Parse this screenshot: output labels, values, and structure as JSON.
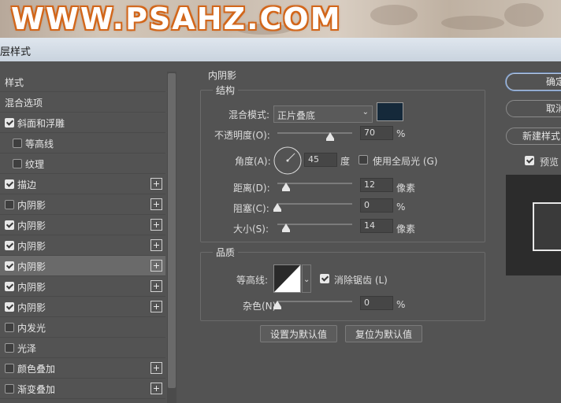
{
  "watermark": {
    "text": "WWW.PSAHZ.COM"
  },
  "dialog": {
    "title": "层样式"
  },
  "left_list": {
    "items": [
      {
        "label": "样式",
        "checkbox": false,
        "checked": false,
        "plus": false,
        "indent": false,
        "active": false
      },
      {
        "label": "混合选项",
        "checkbox": false,
        "checked": false,
        "plus": false,
        "indent": false,
        "active": false
      },
      {
        "label": "斜面和浮雕",
        "checkbox": true,
        "checked": true,
        "plus": false,
        "indent": false,
        "active": false
      },
      {
        "label": "等高线",
        "checkbox": true,
        "checked": false,
        "plus": false,
        "indent": true,
        "active": false
      },
      {
        "label": "纹理",
        "checkbox": true,
        "checked": false,
        "plus": false,
        "indent": true,
        "active": false
      },
      {
        "label": "描边",
        "checkbox": true,
        "checked": true,
        "plus": true,
        "indent": false,
        "active": false
      },
      {
        "label": "内阴影",
        "checkbox": true,
        "checked": false,
        "plus": true,
        "indent": false,
        "active": false
      },
      {
        "label": "内阴影",
        "checkbox": true,
        "checked": true,
        "plus": true,
        "indent": false,
        "active": false
      },
      {
        "label": "内阴影",
        "checkbox": true,
        "checked": true,
        "plus": true,
        "indent": false,
        "active": false
      },
      {
        "label": "内阴影",
        "checkbox": true,
        "checked": true,
        "plus": true,
        "indent": false,
        "active": true
      },
      {
        "label": "内阴影",
        "checkbox": true,
        "checked": true,
        "plus": true,
        "indent": false,
        "active": false
      },
      {
        "label": "内阴影",
        "checkbox": true,
        "checked": true,
        "plus": true,
        "indent": false,
        "active": false
      },
      {
        "label": "内发光",
        "checkbox": true,
        "checked": false,
        "plus": false,
        "indent": false,
        "active": false
      },
      {
        "label": "光泽",
        "checkbox": true,
        "checked": false,
        "plus": false,
        "indent": false,
        "active": false
      },
      {
        "label": "颜色叠加",
        "checkbox": true,
        "checked": false,
        "plus": true,
        "indent": false,
        "active": false
      },
      {
        "label": "渐变叠加",
        "checkbox": true,
        "checked": false,
        "plus": true,
        "indent": false,
        "active": false
      }
    ]
  },
  "inner_shadow": {
    "section_title": "内阴影",
    "structure_title": "结构",
    "blend_mode_label": "混合模式:",
    "blend_mode_value": "正片叠底",
    "shadow_color": "#15293a",
    "opacity_label": "不透明度(O):",
    "opacity_value": "70",
    "opacity_unit": "%",
    "opacity_level": 0.7,
    "angle_label": "角度(A):",
    "angle_value": "45",
    "angle_unit": "度",
    "angle_degrees": 45,
    "global_light_label": "使用全局光 (G)",
    "global_light_checked": false,
    "distance_label": "距离(D):",
    "distance_value": "12",
    "distance_unit": "像素",
    "distance_level": 0.12,
    "choke_label": "阻塞(C):",
    "choke_value": "0",
    "choke_unit": "%",
    "choke_level": 0.0,
    "size_label": "大小(S):",
    "size_value": "14",
    "size_unit": "像素",
    "size_level": 0.12,
    "quality_title": "品质",
    "contour_label": "等高线:",
    "anti_alias_label": "消除锯齿 (L)",
    "anti_alias_checked": true,
    "noise_label": "杂色(N):",
    "noise_value": "0",
    "noise_unit": "%",
    "noise_level": 0.0,
    "make_default_label": "设置为默认值",
    "reset_default_label": "复位为默认值"
  },
  "right_panel": {
    "ok_label": "确定",
    "cancel_label": "取消",
    "new_style_label": "新建样式...",
    "preview_label": "预览",
    "preview_checked": true
  }
}
